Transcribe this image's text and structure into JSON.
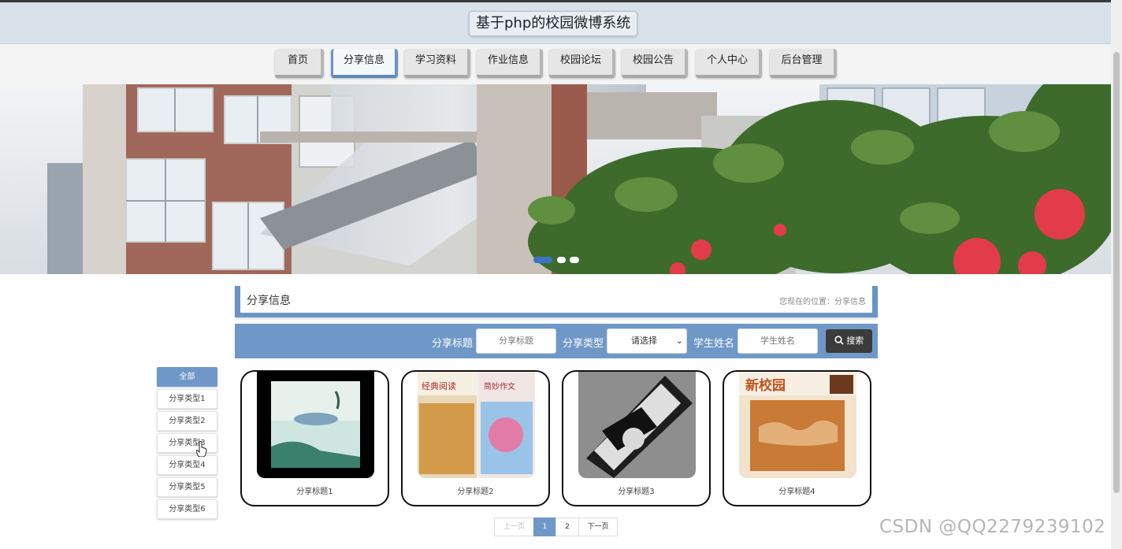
{
  "header": {
    "title": "基于php的校园微博系统"
  },
  "nav": {
    "items": [
      {
        "label": "首页",
        "active": false
      },
      {
        "label": "分享信息",
        "active": true
      },
      {
        "label": "学习资料",
        "active": false
      },
      {
        "label": "作业信息",
        "active": false
      },
      {
        "label": "校园论坛",
        "active": false
      },
      {
        "label": "校园公告",
        "active": false
      },
      {
        "label": "个人中心",
        "active": false
      },
      {
        "label": "后台管理",
        "active": false
      }
    ]
  },
  "carousel": {
    "slide_count": 3,
    "active_index": 0
  },
  "page_title": {
    "title": "分享信息",
    "location": "您现在的位置：分享信息"
  },
  "search": {
    "title_label": "分享标题",
    "title_placeholder": "分享标题",
    "type_label": "分享类型",
    "type_selected": "请选择",
    "name_label": "学生姓名",
    "name_placeholder": "学生姓名",
    "button": "搜索"
  },
  "categories": [
    "全部",
    "分享类型1",
    "分享类型2",
    "分享类型3",
    "分享类型4",
    "分享类型5",
    "分享类型6"
  ],
  "cards": [
    {
      "caption": "分享标题1"
    },
    {
      "caption": "分享标题2"
    },
    {
      "caption": "分享标题3"
    },
    {
      "caption": "分享标题4"
    }
  ],
  "pagination": {
    "prev": "上一页",
    "pages": [
      "1",
      "2"
    ],
    "current": "1",
    "next": "下一页"
  },
  "watermark": "CSDN @QQ2279239102",
  "colors": {
    "accent": "#6f98c8",
    "header_bg": "#d9e2eb",
    "dark_button": "#3b3b3b"
  }
}
